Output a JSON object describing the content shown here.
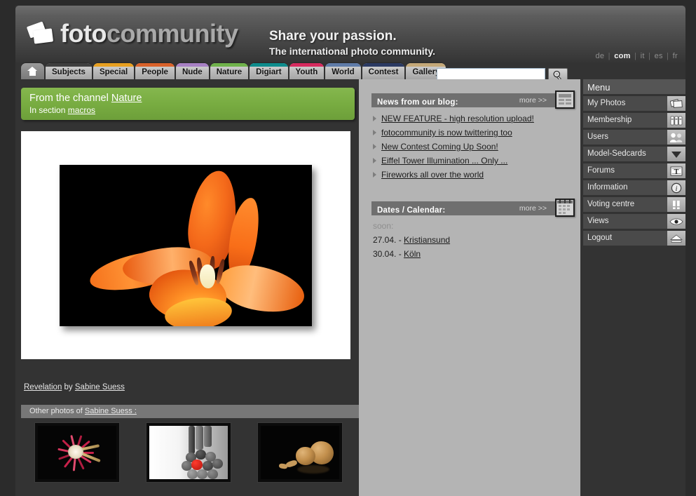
{
  "brand": {
    "logo_part1": "foto",
    "logo_part2": "community",
    "logo_icon": "camera-icon",
    "tagline_line1": "Share your passion.",
    "tagline_line2": "The international photo community."
  },
  "languages": {
    "items": [
      "de",
      "com",
      "it",
      "es",
      "fr"
    ],
    "active": "com"
  },
  "tabs": [
    {
      "label": "",
      "name": "tab-home",
      "icon": "home-icon",
      "color": "#8a8a8a",
      "home": true
    },
    {
      "label": "Subjects",
      "name": "tab-subjects",
      "color": "#3f3f3f"
    },
    {
      "label": "Special",
      "name": "tab-special",
      "color": "#e8a game"
    },
    {
      "label": "People",
      "name": "tab-people",
      "color": "#d9622a"
    },
    {
      "label": "Nude",
      "name": "tab-nude",
      "color": "#a780c4"
    },
    {
      "label": "Nature",
      "name": "tab-nature",
      "color": "#6fb24a"
    },
    {
      "label": "Digiart",
      "name": "tab-digiart",
      "color": "#0d8c8c"
    },
    {
      "label": "Youth",
      "name": "tab-youth",
      "color": "#d62a5e"
    },
    {
      "label": "World",
      "name": "tab-world",
      "color": "#5f7ba8"
    },
    {
      "label": "Contest",
      "name": "tab-contest",
      "color": "#2b3a63"
    },
    {
      "label": "Gallery",
      "name": "tab-gallery",
      "color": "#c4a878"
    }
  ],
  "tab_colors": {
    "subjects": "#3f3f3f",
    "special": "#e8a020",
    "people": "#d9622a",
    "nude": "#a780c4",
    "nature": "#6fb24a",
    "digiart": "#0d8c8c",
    "youth": "#d62a5e",
    "world": "#5f7ba8",
    "contest": "#2b3a63",
    "gallery": "#c4a878"
  },
  "search": {
    "value": "",
    "placeholder": "",
    "button_icon": "search-icon"
  },
  "channel_banner": {
    "prefix": "From the channel ",
    "channel": "Nature",
    "section_prefix": "In section ",
    "section": "macros",
    "color": "#77ab40"
  },
  "photo": {
    "title": "Revelation",
    "by_word": " by ",
    "author": "Sabine Suess",
    "subject": "orange tulip flower on black background"
  },
  "other_photos": {
    "prefix": "Other photos of ",
    "author": "Sabine Suess :",
    "thumbnails": [
      {
        "name": "thumbnail-dried-flower",
        "alt": "dried red and white flower on black"
      },
      {
        "name": "thumbnail-pencils",
        "alt": "grey pencils with one red pencil"
      },
      {
        "name": "thumbnail-walnuts",
        "alt": "walnuts on black background"
      }
    ]
  },
  "news_panel": {
    "title": "News from our blog:",
    "more_label": "more >>",
    "icon": "newspaper-icon",
    "items": [
      "NEW FEATURE - high resolution upload!",
      "fotocommunity is now twittering too",
      "New Contest Coming Up Soon!",
      "Eiffel Tower Illumination ... Only ...",
      "Fireworks all over the world"
    ]
  },
  "dates_panel": {
    "title": "Dates / Calendar:",
    "more_label": "more >>",
    "icon": "calendar-icon",
    "soon_label": "soon:",
    "entries": [
      {
        "date": "27.04. - ",
        "place": "Kristiansund"
      },
      {
        "date": "30.04. - ",
        "place": "Köln"
      }
    ]
  },
  "menu": {
    "title": "Menu",
    "items": [
      {
        "label": "My Photos",
        "icon": "photos-stack-icon"
      },
      {
        "label": "Membership",
        "icon": "membership-cards-icon"
      },
      {
        "label": "Users",
        "icon": "users-icon"
      },
      {
        "label": "Model-Sedcards",
        "icon": "chevron-down-icon"
      },
      {
        "label": "Forums",
        "icon": "forum-text-icon"
      },
      {
        "label": "Information",
        "icon": "info-circle-icon"
      },
      {
        "label": "Voting centre",
        "icon": "voting-bars-icon"
      },
      {
        "label": "Views",
        "icon": "eye-icon"
      },
      {
        "label": "Logout",
        "icon": "eject-icon"
      }
    ]
  }
}
